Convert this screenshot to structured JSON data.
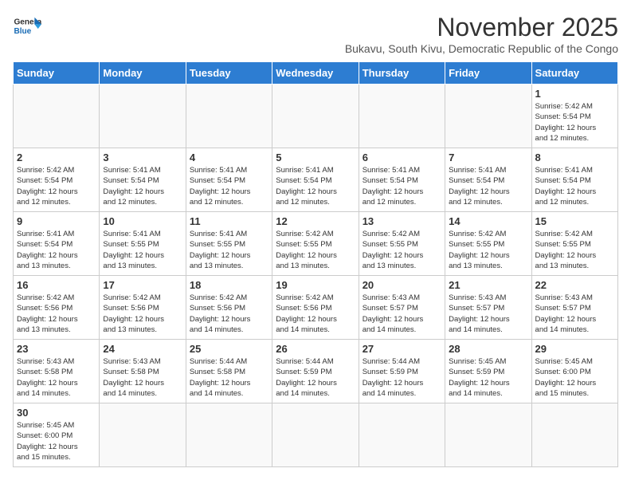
{
  "logo": {
    "line1": "General",
    "line2": "Blue"
  },
  "title": "November 2025",
  "subtitle": "Bukavu, South Kivu, Democratic Republic of the Congo",
  "days_of_week": [
    "Sunday",
    "Monday",
    "Tuesday",
    "Wednesday",
    "Thursday",
    "Friday",
    "Saturday"
  ],
  "weeks": [
    [
      {
        "day": "",
        "info": ""
      },
      {
        "day": "",
        "info": ""
      },
      {
        "day": "",
        "info": ""
      },
      {
        "day": "",
        "info": ""
      },
      {
        "day": "",
        "info": ""
      },
      {
        "day": "",
        "info": ""
      },
      {
        "day": "1",
        "info": "Sunrise: 5:42 AM\nSunset: 5:54 PM\nDaylight: 12 hours\nand 12 minutes."
      }
    ],
    [
      {
        "day": "2",
        "info": "Sunrise: 5:42 AM\nSunset: 5:54 PM\nDaylight: 12 hours\nand 12 minutes."
      },
      {
        "day": "3",
        "info": "Sunrise: 5:41 AM\nSunset: 5:54 PM\nDaylight: 12 hours\nand 12 minutes."
      },
      {
        "day": "4",
        "info": "Sunrise: 5:41 AM\nSunset: 5:54 PM\nDaylight: 12 hours\nand 12 minutes."
      },
      {
        "day": "5",
        "info": "Sunrise: 5:41 AM\nSunset: 5:54 PM\nDaylight: 12 hours\nand 12 minutes."
      },
      {
        "day": "6",
        "info": "Sunrise: 5:41 AM\nSunset: 5:54 PM\nDaylight: 12 hours\nand 12 minutes."
      },
      {
        "day": "7",
        "info": "Sunrise: 5:41 AM\nSunset: 5:54 PM\nDaylight: 12 hours\nand 12 minutes."
      },
      {
        "day": "8",
        "info": "Sunrise: 5:41 AM\nSunset: 5:54 PM\nDaylight: 12 hours\nand 12 minutes."
      }
    ],
    [
      {
        "day": "9",
        "info": "Sunrise: 5:41 AM\nSunset: 5:54 PM\nDaylight: 12 hours\nand 13 minutes."
      },
      {
        "day": "10",
        "info": "Sunrise: 5:41 AM\nSunset: 5:55 PM\nDaylight: 12 hours\nand 13 minutes."
      },
      {
        "day": "11",
        "info": "Sunrise: 5:41 AM\nSunset: 5:55 PM\nDaylight: 12 hours\nand 13 minutes."
      },
      {
        "day": "12",
        "info": "Sunrise: 5:42 AM\nSunset: 5:55 PM\nDaylight: 12 hours\nand 13 minutes."
      },
      {
        "day": "13",
        "info": "Sunrise: 5:42 AM\nSunset: 5:55 PM\nDaylight: 12 hours\nand 13 minutes."
      },
      {
        "day": "14",
        "info": "Sunrise: 5:42 AM\nSunset: 5:55 PM\nDaylight: 12 hours\nand 13 minutes."
      },
      {
        "day": "15",
        "info": "Sunrise: 5:42 AM\nSunset: 5:55 PM\nDaylight: 12 hours\nand 13 minutes."
      }
    ],
    [
      {
        "day": "16",
        "info": "Sunrise: 5:42 AM\nSunset: 5:56 PM\nDaylight: 12 hours\nand 13 minutes."
      },
      {
        "day": "17",
        "info": "Sunrise: 5:42 AM\nSunset: 5:56 PM\nDaylight: 12 hours\nand 13 minutes."
      },
      {
        "day": "18",
        "info": "Sunrise: 5:42 AM\nSunset: 5:56 PM\nDaylight: 12 hours\nand 14 minutes."
      },
      {
        "day": "19",
        "info": "Sunrise: 5:42 AM\nSunset: 5:56 PM\nDaylight: 12 hours\nand 14 minutes."
      },
      {
        "day": "20",
        "info": "Sunrise: 5:43 AM\nSunset: 5:57 PM\nDaylight: 12 hours\nand 14 minutes."
      },
      {
        "day": "21",
        "info": "Sunrise: 5:43 AM\nSunset: 5:57 PM\nDaylight: 12 hours\nand 14 minutes."
      },
      {
        "day": "22",
        "info": "Sunrise: 5:43 AM\nSunset: 5:57 PM\nDaylight: 12 hours\nand 14 minutes."
      }
    ],
    [
      {
        "day": "23",
        "info": "Sunrise: 5:43 AM\nSunset: 5:58 PM\nDaylight: 12 hours\nand 14 minutes."
      },
      {
        "day": "24",
        "info": "Sunrise: 5:43 AM\nSunset: 5:58 PM\nDaylight: 12 hours\nand 14 minutes."
      },
      {
        "day": "25",
        "info": "Sunrise: 5:44 AM\nSunset: 5:58 PM\nDaylight: 12 hours\nand 14 minutes."
      },
      {
        "day": "26",
        "info": "Sunrise: 5:44 AM\nSunset: 5:59 PM\nDaylight: 12 hours\nand 14 minutes."
      },
      {
        "day": "27",
        "info": "Sunrise: 5:44 AM\nSunset: 5:59 PM\nDaylight: 12 hours\nand 14 minutes."
      },
      {
        "day": "28",
        "info": "Sunrise: 5:45 AM\nSunset: 5:59 PM\nDaylight: 12 hours\nand 14 minutes."
      },
      {
        "day": "29",
        "info": "Sunrise: 5:45 AM\nSunset: 6:00 PM\nDaylight: 12 hours\nand 15 minutes."
      }
    ],
    [
      {
        "day": "30",
        "info": "Sunrise: 5:45 AM\nSunset: 6:00 PM\nDaylight: 12 hours\nand 15 minutes."
      },
      {
        "day": "",
        "info": ""
      },
      {
        "day": "",
        "info": ""
      },
      {
        "day": "",
        "info": ""
      },
      {
        "day": "",
        "info": ""
      },
      {
        "day": "",
        "info": ""
      },
      {
        "day": "",
        "info": ""
      }
    ]
  ]
}
